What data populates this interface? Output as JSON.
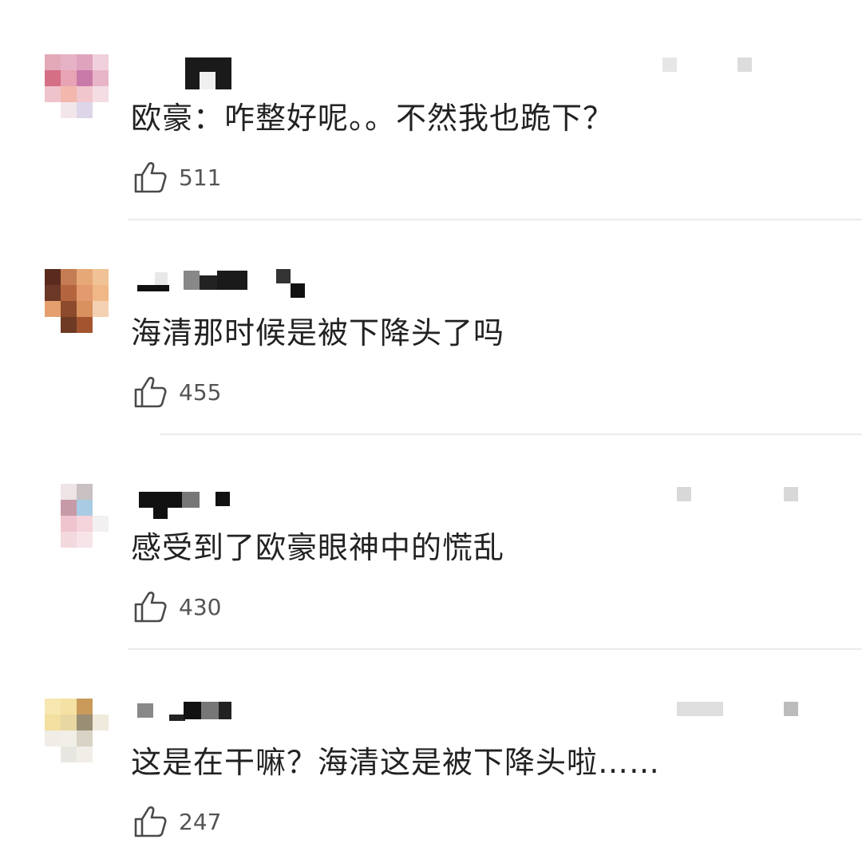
{
  "comments": [
    {
      "text": "欧豪：咋整好呢。。不然我也跪下？",
      "likes": "511"
    },
    {
      "text": "海清那时候是被下降头了吗",
      "likes": "455"
    },
    {
      "text": "感受到了欧豪眼神中的慌乱",
      "likes": "430"
    },
    {
      "text": "这是在干嘛？海清这是被下降头啦……",
      "likes": "247"
    }
  ],
  "icons": {
    "like": "thumbs-up-icon"
  },
  "colors": {
    "text": "#222222",
    "count": "#555555",
    "divider": "#ececec"
  }
}
